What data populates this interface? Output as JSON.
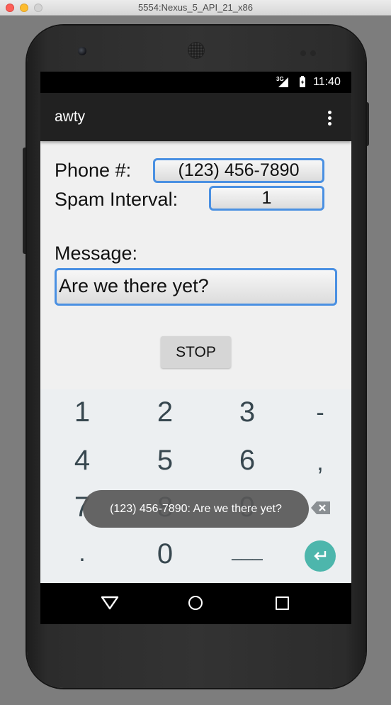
{
  "window": {
    "title": "5554:Nexus_5_API_21_x86"
  },
  "status_bar": {
    "network": "3G",
    "time": "11:40"
  },
  "app_bar": {
    "title": "awty",
    "overflow_icon": "more-vert-icon"
  },
  "form": {
    "phone_label": "Phone #:",
    "phone_value": "(123) 456-7890",
    "interval_label": "Spam Interval:",
    "interval_value": "1",
    "message_label": "Message:",
    "message_value": "Are we there yet?",
    "stop_label": "STOP"
  },
  "keyboard": {
    "row1": [
      "1",
      "2",
      "3",
      "-"
    ],
    "row2": [
      "4",
      "5",
      "6",
      ","
    ],
    "row3": [
      "7",
      "8",
      "9"
    ],
    "row4": [
      ".",
      "0",
      "___"
    ],
    "backspace_icon": "backspace-icon",
    "enter_icon": "enter-icon"
  },
  "toast": {
    "text": "(123) 456-7890: Are we there yet?"
  },
  "nav_bar": {
    "back_icon": "back-triangle-icon",
    "home_icon": "home-circle-icon",
    "recents_icon": "recents-square-icon"
  },
  "colors": {
    "field_border": "#4a90e2",
    "app_bar": "#212121",
    "enter_button": "#4db6ac",
    "keyboard_bg": "#eceff1"
  }
}
